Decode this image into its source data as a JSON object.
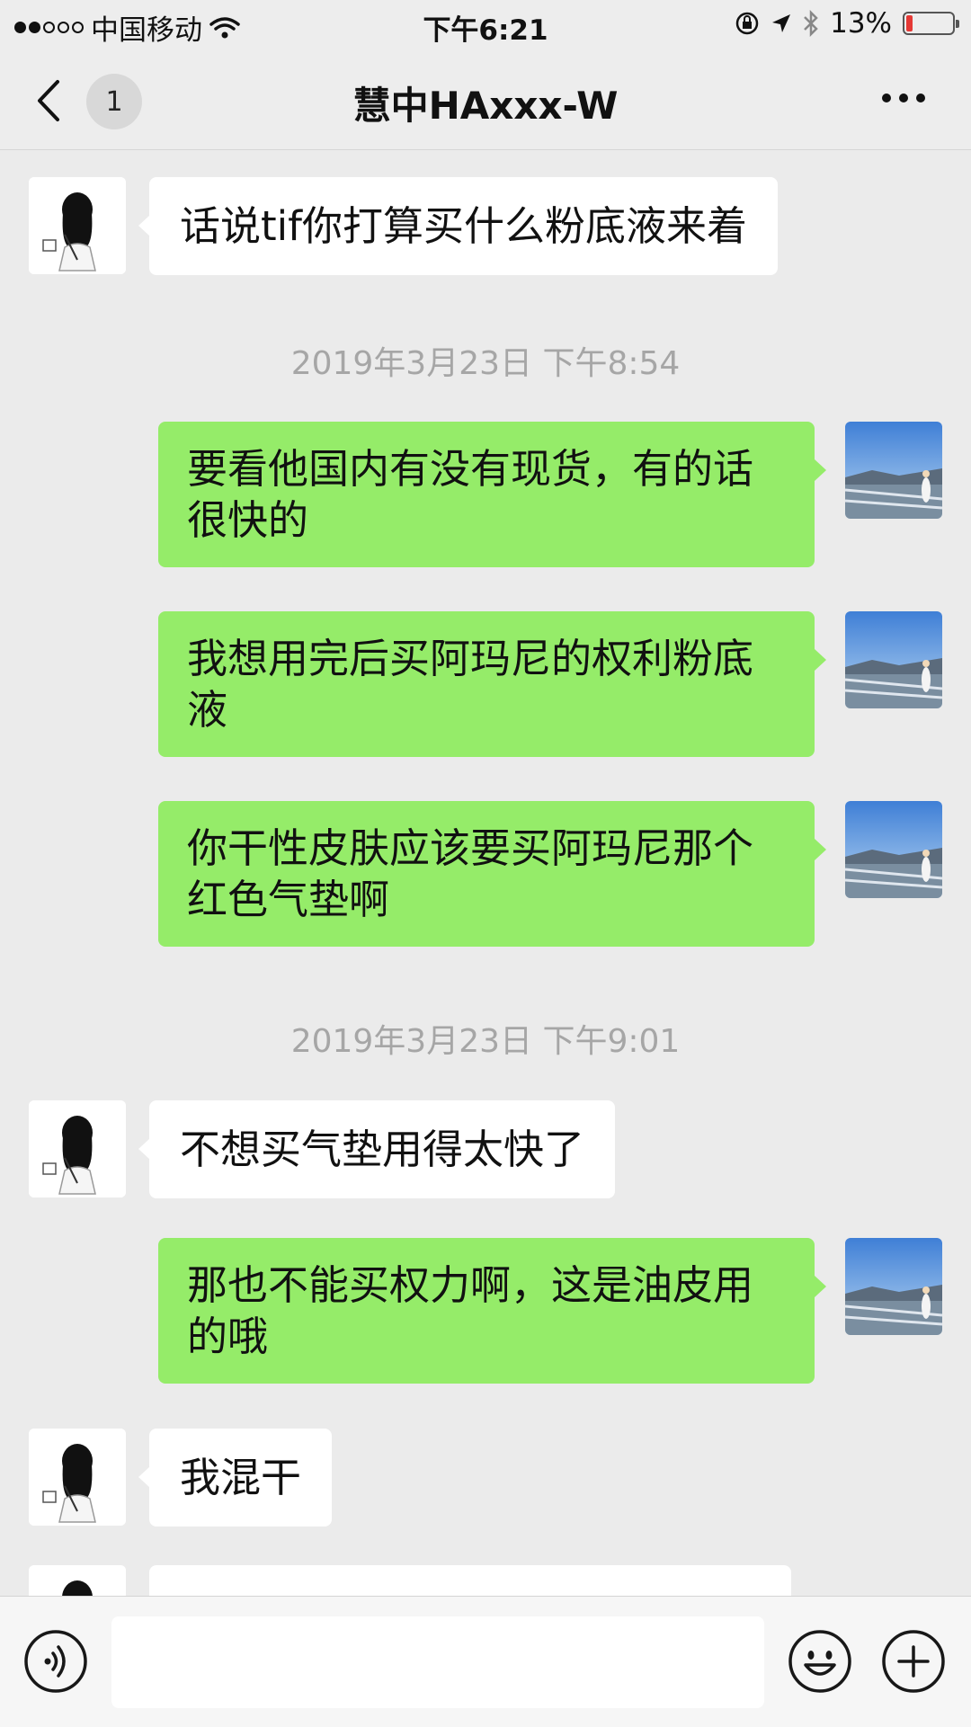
{
  "status_bar": {
    "carrier": "中国移动",
    "time": "下午6:21",
    "battery_percent": "13%",
    "battery_level": 0.13
  },
  "nav": {
    "back_badge": "1",
    "title": "慧中HAxxx-W"
  },
  "messages": [
    {
      "side": "left",
      "text": "话说tif你打算买什么粉底液来着"
    },
    {
      "type": "timestamp",
      "text": "2019年3月23日 下午8:54"
    },
    {
      "side": "right",
      "text": "要看他国内有没有现货，有的话很快的"
    },
    {
      "side": "right",
      "text": "我想用完后买阿玛尼的权利粉底液"
    },
    {
      "side": "right",
      "text": "你干性皮肤应该要买阿玛尼那个红色气垫啊"
    },
    {
      "type": "timestamp",
      "text": "2019年3月23日 下午9:01"
    },
    {
      "side": "left",
      "text": "不想买气垫用得太快了"
    },
    {
      "side": "right",
      "text": "那也不能买权力啊，这是油皮用的哦"
    },
    {
      "side": "left",
      "text": "我混干"
    }
  ],
  "input": {
    "value": ""
  },
  "icons": {
    "back": "chevron-left-icon",
    "more": "more-dots-icon",
    "voice": "voice-icon",
    "emoji": "emoji-icon",
    "plus": "plus-icon"
  },
  "colors": {
    "sent_bubble": "#95ec69",
    "received_bubble": "#ffffff",
    "background": "#ebebeb",
    "battery_low": "#e53935"
  }
}
